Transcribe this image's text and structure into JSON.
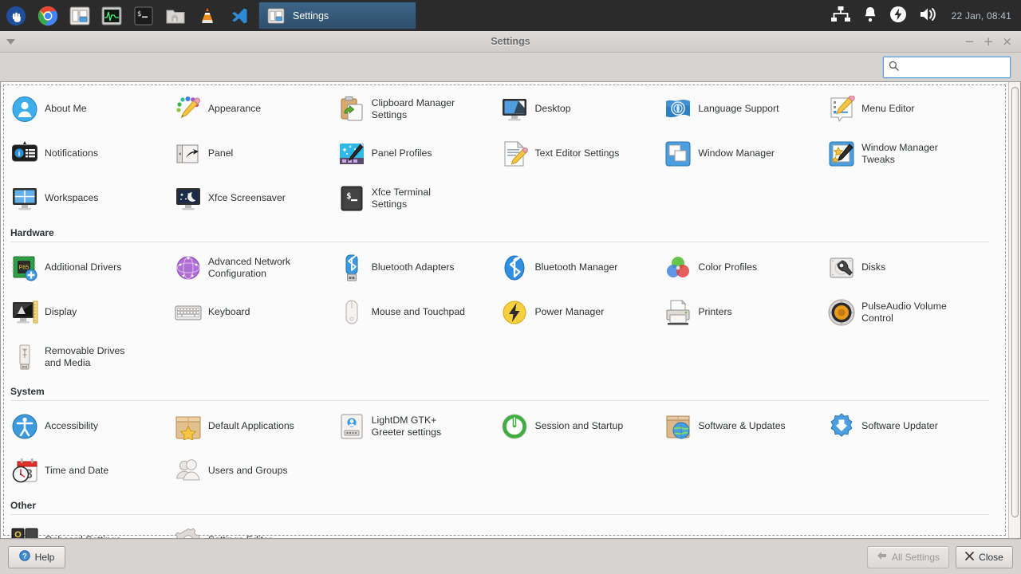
{
  "taskbar": {
    "launchers": [
      {
        "name": "whisker-menu-icon",
        "label": "Applications Menu"
      },
      {
        "name": "chrome-icon",
        "label": "Google Chrome"
      },
      {
        "name": "settings-manager-icon",
        "label": "Settings Manager"
      },
      {
        "name": "system-monitor-icon",
        "label": "System Monitor"
      },
      {
        "name": "terminal-icon",
        "label": "Terminal"
      },
      {
        "name": "file-manager-icon",
        "label": "File Manager"
      },
      {
        "name": "vlc-icon",
        "label": "VLC Media Player"
      },
      {
        "name": "vscode-icon",
        "label": "Visual Studio Code"
      }
    ],
    "task_button": {
      "label": "Settings",
      "icon": "settings-manager-icon"
    },
    "tray": [
      {
        "name": "network-icon"
      },
      {
        "name": "notification-bell-icon"
      },
      {
        "name": "power-bolt-icon"
      },
      {
        "name": "volume-icon"
      }
    ],
    "clock": "22 Jan, 08:41"
  },
  "window": {
    "title": "Settings",
    "controls": {
      "minimize": "−",
      "maximize": "+",
      "close": "×"
    },
    "menu_icon": "window-menu-icon"
  },
  "search": {
    "value": "",
    "placeholder": "",
    "icon": "search-icon"
  },
  "groups": [
    {
      "id": "personal",
      "title": "",
      "items": [
        {
          "label": "About Me",
          "icon": "about-me-icon"
        },
        {
          "label": "Appearance",
          "icon": "appearance-icon"
        },
        {
          "label": "Clipboard Manager Settings",
          "icon": "clipboard-manager-icon"
        },
        {
          "label": "Desktop",
          "icon": "desktop-icon"
        },
        {
          "label": "Language Support",
          "icon": "language-support-icon"
        },
        {
          "label": "Menu Editor",
          "icon": "menu-editor-icon"
        },
        {
          "label": "Notifications",
          "icon": "notifications-icon"
        },
        {
          "label": "Panel",
          "icon": "panel-icon"
        },
        {
          "label": "Panel Profiles",
          "icon": "panel-profiles-icon"
        },
        {
          "label": "Text Editor Settings",
          "icon": "text-editor-icon"
        },
        {
          "label": "Window Manager",
          "icon": "window-manager-icon"
        },
        {
          "label": "Window Manager Tweaks",
          "icon": "window-manager-tweaks-icon"
        },
        {
          "label": "Workspaces",
          "icon": "workspaces-icon"
        },
        {
          "label": "Xfce Screensaver",
          "icon": "screensaver-icon"
        },
        {
          "label": "Xfce Terminal Settings",
          "icon": "terminal-settings-icon"
        }
      ]
    },
    {
      "id": "hardware",
      "title": "Hardware",
      "items": [
        {
          "label": "Additional Drivers",
          "icon": "additional-drivers-icon"
        },
        {
          "label": "Advanced Network Configuration",
          "icon": "network-config-icon"
        },
        {
          "label": "Bluetooth Adapters",
          "icon": "bluetooth-adapter-icon"
        },
        {
          "label": "Bluetooth Manager",
          "icon": "bluetooth-manager-icon"
        },
        {
          "label": "Color Profiles",
          "icon": "color-profiles-icon"
        },
        {
          "label": "Disks",
          "icon": "disks-icon"
        },
        {
          "label": "Display",
          "icon": "display-icon"
        },
        {
          "label": "Keyboard",
          "icon": "keyboard-icon"
        },
        {
          "label": "Mouse and Touchpad",
          "icon": "mouse-icon"
        },
        {
          "label": "Power Manager",
          "icon": "power-manager-icon"
        },
        {
          "label": "Printers",
          "icon": "printers-icon"
        },
        {
          "label": "PulseAudio Volume Control",
          "icon": "pulseaudio-icon"
        },
        {
          "label": "Removable Drives and Media",
          "icon": "removable-drives-icon"
        }
      ]
    },
    {
      "id": "system",
      "title": "System",
      "items": [
        {
          "label": "Accessibility",
          "icon": "accessibility-icon"
        },
        {
          "label": "Default Applications",
          "icon": "default-applications-icon"
        },
        {
          "label": "LightDM GTK+ Greeter settings",
          "icon": "lightdm-greeter-icon"
        },
        {
          "label": "Session and Startup",
          "icon": "session-startup-icon"
        },
        {
          "label": "Software & Updates",
          "icon": "software-updates-icon"
        },
        {
          "label": "Software Updater",
          "icon": "software-updater-icon"
        },
        {
          "label": "Time and Date",
          "icon": "time-date-icon"
        },
        {
          "label": "Users and Groups",
          "icon": "users-groups-icon"
        }
      ]
    },
    {
      "id": "other",
      "title": "Other",
      "items": [
        {
          "label": "Onboard Settings",
          "icon": "onboard-settings-icon"
        },
        {
          "label": "Settings Editor",
          "icon": "settings-editor-icon"
        }
      ]
    }
  ],
  "actions": {
    "help_label": "Help",
    "all_settings_label": "All Settings",
    "all_settings_disabled": true,
    "close_label": "Close"
  },
  "colors": {
    "taskbar_bg": "#2b2b2b",
    "task_button_bg": "#3c6487",
    "window_bg": "#d6d3d1",
    "content_bg": "#fbfbfb",
    "accent_blue": "#5aa0d8",
    "text": "#2e3436",
    "clock_text": "#b8c4cc"
  }
}
